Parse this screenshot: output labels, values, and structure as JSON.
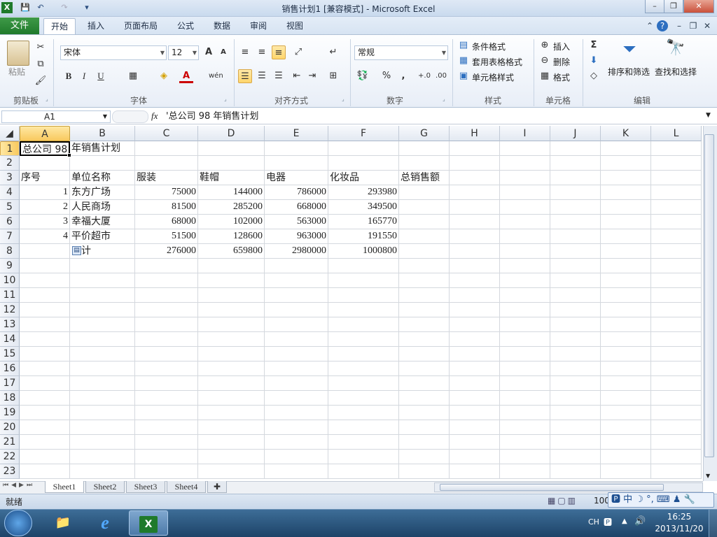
{
  "window": {
    "title": "销售计划1  [兼容模式] - Microsoft Excel",
    "app_icon": "X",
    "minimize": "–",
    "restore": "❐",
    "close": "✕"
  },
  "quick_access": {
    "save": "💾",
    "undo": "↶",
    "redo": "↷",
    "customize": "▾"
  },
  "ribbon_tabs": {
    "file": "文件",
    "tabs": [
      "开始",
      "插入",
      "页面布局",
      "公式",
      "数据",
      "审阅",
      "视图"
    ]
  },
  "ribbon": {
    "clipboard": {
      "paste": "粘贴",
      "group": "剪贴板"
    },
    "font": {
      "name": "宋体",
      "size": "12",
      "bold": "B",
      "italic": "I",
      "underline": "U",
      "group": "字体",
      "grow": "A",
      "shrink": "A",
      "color_a": "A",
      "phonetic": "wén"
    },
    "alignment": {
      "group": "对齐方式"
    },
    "number": {
      "format": "常规",
      "percent": "%",
      "comma": ",",
      "inc": "+.0",
      "dec": ".00",
      "group": "数字"
    },
    "styles": {
      "conditional": "条件格式",
      "table": "套用表格格式",
      "cell_styles": "单元格样式",
      "group": "样式"
    },
    "cells": {
      "insert": "插入",
      "delete": "删除",
      "format": "格式",
      "group": "单元格"
    },
    "editing": {
      "sum": "Σ",
      "sort": "排序和筛选",
      "find": "查找和选择",
      "group": "编辑"
    }
  },
  "formula_bar": {
    "name_box": "A1",
    "fx": "fx",
    "content": "'总公司 98 年销售计划"
  },
  "columns": [
    "A",
    "B",
    "C",
    "D",
    "E",
    "F",
    "G",
    "H",
    "I",
    "J",
    "K",
    "L"
  ],
  "rows": [
    "1",
    "2",
    "3",
    "4",
    "5",
    "6",
    "7",
    "8",
    "9",
    "10",
    "11",
    "12",
    "13",
    "14",
    "15",
    "16",
    "17",
    "18",
    "19",
    "20",
    "21",
    "22",
    "23"
  ],
  "cells": {
    "A1": "总公司 98",
    "B1": "年销售计划",
    "A3": "序号",
    "B3": "单位名称",
    "C3": "服装",
    "D3": "鞋帽",
    "E3": "电器",
    "F3": "化妆品",
    "G3": "总销售额",
    "A4": "1",
    "B4": "东方广场",
    "C4": "75000",
    "D4": "144000",
    "E4": "786000",
    "F4": "293980",
    "A5": "2",
    "B5": "人民商场",
    "C5": "81500",
    "D5": "285200",
    "E5": "668000",
    "F5": "349500",
    "A6": "3",
    "B6": "幸福大厦",
    "C6": "68000",
    "D6": "102000",
    "E6": "563000",
    "F6": "165770",
    "A7": "4",
    "B7": "平价超市",
    "C7": "51500",
    "D7": "128600",
    "E7": "963000",
    "F7": "191550",
    "B8": "计",
    "C8": "276000",
    "D8": "659800",
    "E8": "2980000",
    "F8": "1000800"
  },
  "sheets": [
    "Sheet1",
    "Sheet2",
    "Sheet3",
    "Sheet4"
  ],
  "status": {
    "ready": "就绪",
    "zoom": "100"
  },
  "ime": {
    "label": "中"
  },
  "taskbar": {
    "lang": "CH",
    "time": "16:25",
    "date": "2013/11/20"
  }
}
